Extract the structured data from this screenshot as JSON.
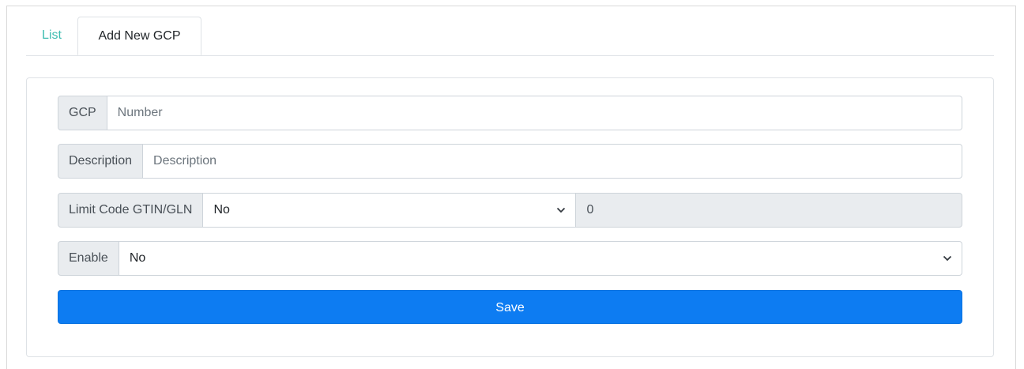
{
  "tabs": [
    {
      "label": "List"
    },
    {
      "label": "Add New GCP"
    }
  ],
  "form": {
    "gcp": {
      "label": "GCP",
      "placeholder": "Number",
      "value": ""
    },
    "description": {
      "label": "Description",
      "placeholder": "Description",
      "value": ""
    },
    "limit": {
      "label": "Limit Code GTIN/GLN",
      "selected": "No",
      "readonly_value": "0"
    },
    "enable": {
      "label": "Enable",
      "selected": "No"
    },
    "save_label": "Save"
  },
  "colors": {
    "accent_tab": "#3fbdb1",
    "primary_button": "#0d7cf2",
    "addon_bg": "#e9ecef"
  },
  "icons": {
    "select_caret": "chevron-down-icon"
  }
}
